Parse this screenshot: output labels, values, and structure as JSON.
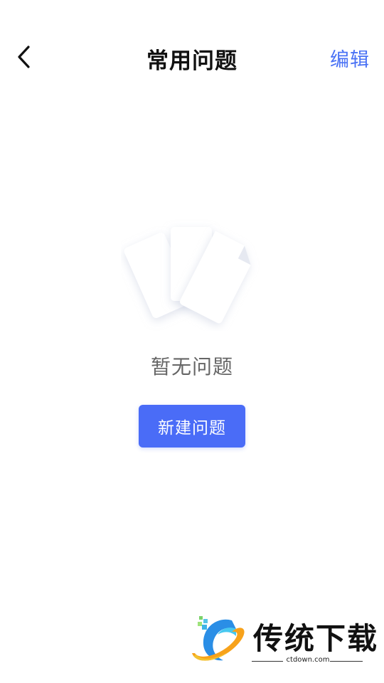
{
  "header": {
    "title": "常用问题",
    "edit_label": "编辑"
  },
  "empty_state": {
    "message": "暂无问题",
    "button_label": "新建问题"
  },
  "watermark": {
    "brand": "传统下载",
    "site": "ctdown.com"
  },
  "colors": {
    "accent": "#4a6cf7",
    "edit_text": "#4a72f5",
    "title_text": "#111111",
    "empty_text": "#666666"
  },
  "icons": {
    "back": "chevron-left-icon",
    "empty": "empty-documents-icon",
    "watermark_logo": "ctdown-logo-icon"
  }
}
